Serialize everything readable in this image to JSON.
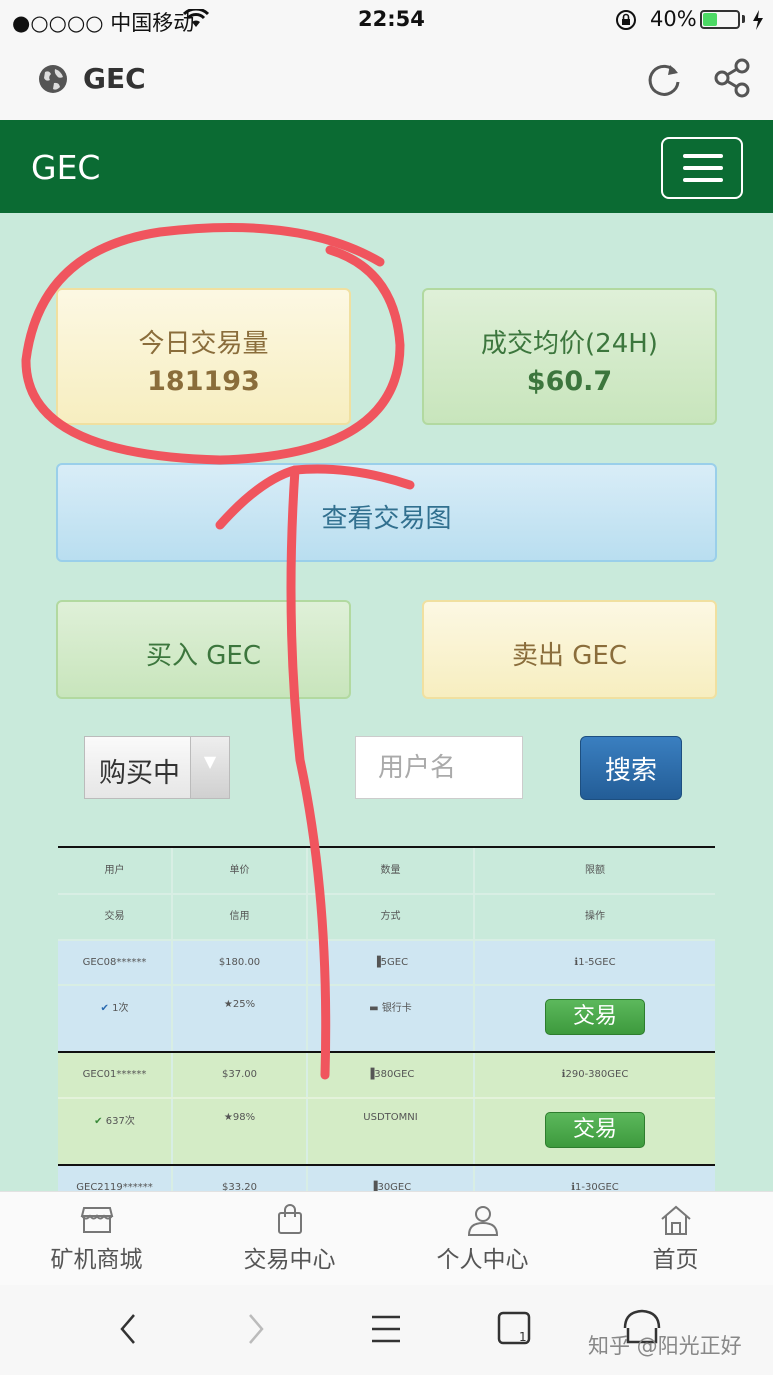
{
  "status_bar": {
    "carrier": "●○○○○ 中国移动",
    "time": "22:54",
    "battery_percent": "40%",
    "battery_level": 0.4
  },
  "browser": {
    "title": "GEC"
  },
  "navbar": {
    "brand": "GEC"
  },
  "stats": {
    "volume_label": "今日交易量",
    "volume_value": "181193",
    "avg_label": "成交均价(24H)",
    "avg_value": "$60.7"
  },
  "actions": {
    "chart_label": "查看交易图",
    "buy_label": "买入 GEC",
    "sell_label": "卖出 GEC"
  },
  "filter": {
    "status_selected": "购买中",
    "username_placeholder": "用户名",
    "search_label": "搜索"
  },
  "table": {
    "headers_row1": [
      "用户",
      "单价",
      "数量",
      "限额"
    ],
    "headers_row2": [
      "交易",
      "信用",
      "方式",
      "操作"
    ],
    "trade_label": "交易",
    "orders": [
      {
        "user": "GEC08******",
        "price": "$180.00",
        "quantity": "5GEC",
        "limit": "1-5GEC",
        "trades": "1次",
        "credit": "25%",
        "method": "银行卡"
      },
      {
        "user": "GEC01******",
        "price": "$37.00",
        "quantity": "380GEC",
        "limit": "290-380GEC",
        "trades": "637次",
        "credit": "98%",
        "method": "USDTOMNI"
      },
      {
        "user": "GEC2119******",
        "price": "$33.20",
        "quantity": "30GEC",
        "limit": "1-30GEC"
      }
    ]
  },
  "tabbar": {
    "items": [
      {
        "label": "矿机商城",
        "icon": "store-icon"
      },
      {
        "label": "交易中心",
        "icon": "bag-icon"
      },
      {
        "label": "个人中心",
        "icon": "person-icon"
      },
      {
        "label": "首页",
        "icon": "home-icon"
      }
    ]
  },
  "watermark": "知乎 @阳光正好",
  "colors": {
    "navbar": "#0b6b33",
    "page_bg": "#c9eadb",
    "annotation": "#f0555e"
  }
}
